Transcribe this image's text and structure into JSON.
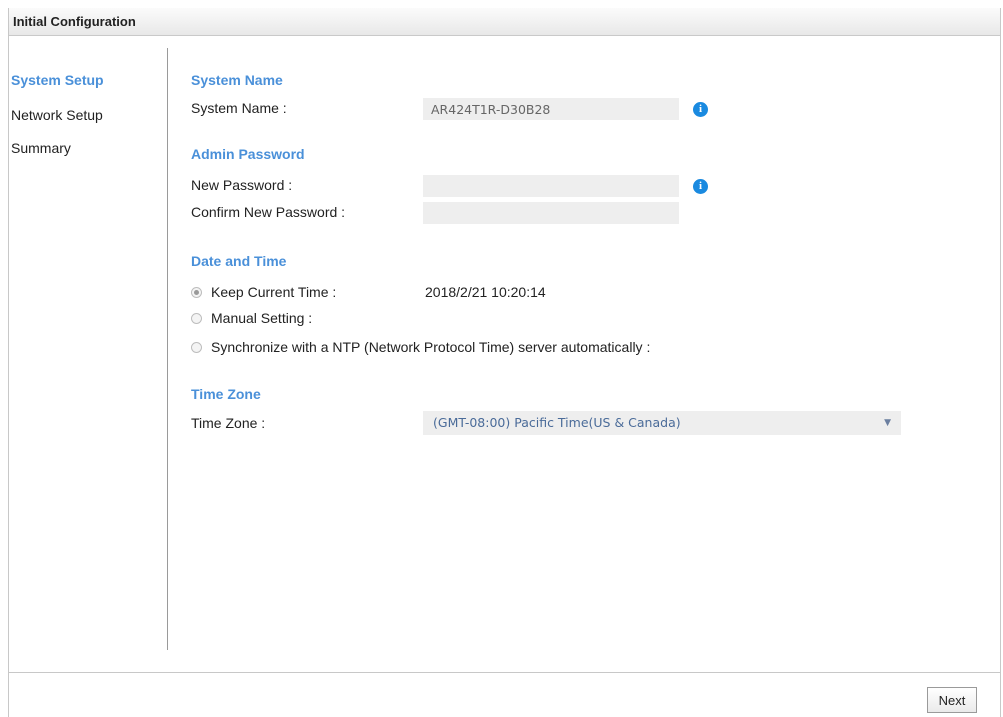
{
  "window": {
    "title": "Initial Configuration"
  },
  "sidebar": {
    "items": [
      {
        "label": "System Setup",
        "active": true
      },
      {
        "label": "Network Setup",
        "active": false
      },
      {
        "label": "Summary",
        "active": false
      }
    ]
  },
  "system_name": {
    "heading": "System Name",
    "label": "System Name :",
    "value": "AR424T1R-D30B28",
    "info_icon": "info-icon"
  },
  "admin_password": {
    "heading": "Admin Password",
    "new_label": "New Password :",
    "new_value": "",
    "confirm_label": "Confirm New Password :",
    "confirm_value": "",
    "info_icon": "info-icon"
  },
  "date_time": {
    "heading": "Date and Time",
    "options": [
      {
        "label": "Keep Current Time :",
        "checked": true
      },
      {
        "label": "Manual Setting :",
        "checked": false
      },
      {
        "label": "Synchronize with a NTP (Network Protocol Time) server automatically :",
        "checked": false
      }
    ],
    "current_time": "2018/2/21 10:20:14"
  },
  "time_zone": {
    "heading": "Time Zone",
    "label": "Time Zone :",
    "selected": "(GMT-08:00) Pacific Time(US & Canada)"
  },
  "footer": {
    "next_label": "Next"
  },
  "colors": {
    "accent": "#4a90d9",
    "info": "#1a8ae0"
  }
}
